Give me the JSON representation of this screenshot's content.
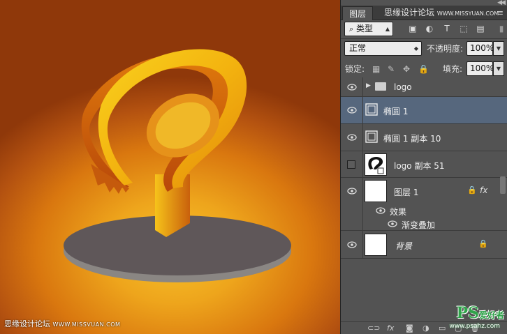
{
  "watermark": {
    "left_cn": "思缘设计论坛",
    "left_url": "WWW.MISSVUAN.COM",
    "top_cn": "思缘设计论坛",
    "top_url": "WWW.MISSYUAN.COM",
    "ps_logo": "PS",
    "ps_text": "爱好者",
    "ps_url": "www.psahz.com"
  },
  "panel": {
    "tab": "图层",
    "filter": {
      "icon": "search-icon",
      "value": "类型"
    },
    "blend_mode": "正常",
    "opacity_label": "不透明度:",
    "opacity_value": "100%",
    "lock_label": "锁定:",
    "fill_label": "填充:",
    "fill_value": "100%"
  },
  "layers": [
    {
      "name": "logo",
      "type": "group",
      "visible": true
    },
    {
      "name": "椭圆 1",
      "type": "shape",
      "visible": true,
      "selected": true
    },
    {
      "name": "椭圆 1 副本 10",
      "type": "shape",
      "visible": true
    },
    {
      "name": "logo 副本 51",
      "type": "image",
      "visible": false
    },
    {
      "name": "图层 1",
      "type": "normal",
      "visible": true,
      "locked": true,
      "fx": "fx",
      "effects_label": "效果",
      "effects": [
        "渐变叠加"
      ]
    },
    {
      "name": "背景",
      "type": "background",
      "visible": true,
      "locked": true
    }
  ],
  "bottom_bar": [
    "link-icon",
    "fx",
    "mask-icon",
    "adjustment-icon",
    "folder-icon",
    "new-layer-icon",
    "trash-icon"
  ],
  "colors": {
    "selected_layer": "#56677d",
    "panel_bg": "#535353",
    "canvas_center": "#f7c22a",
    "canvas_edge": "#8f380a"
  }
}
